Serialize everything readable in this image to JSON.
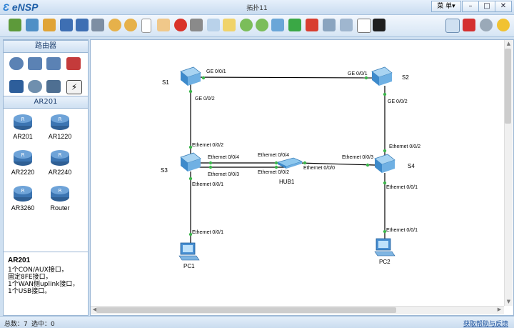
{
  "window": {
    "app_name": "eNSP",
    "title": "拓扑11",
    "menu_label": "菜 单▾",
    "min": "–",
    "restore": "□",
    "close": "✕"
  },
  "toolbar_icons": [
    "new-topology-icon",
    "new-example-icon",
    "open-icon",
    "save-icon",
    "save-as-icon",
    "print-icon",
    "undo-icon",
    "redo-icon",
    "select-icon",
    "hand-icon",
    "delete-icon",
    "delete-all-icon",
    "text-icon",
    "palette-icon",
    "zoom-in-icon",
    "zoom-out-icon",
    "fit-icon",
    "start-icon",
    "stop-icon",
    "capture-icon",
    "topology-icon",
    "fullscreen-icon",
    "terminal-icon",
    "chat-icon",
    "huawei-icon",
    "settings-icon",
    "help-icon"
  ],
  "left_panel": {
    "category_title": "路由器",
    "sub_title": "AR201",
    "devices": [
      "AR201",
      "AR1220",
      "AR2220",
      "AR2240",
      "AR3260",
      "Router"
    ]
  },
  "description": {
    "title": "AR201",
    "lines": [
      "1个CON/AUX接口，",
      "固定8FE接口，",
      "1个WAN侧uplink接口，",
      "1个USB接口。"
    ]
  },
  "topology": {
    "nodes": {
      "s1": "S1",
      "s2": "S2",
      "s3": "S3",
      "s4": "S4",
      "hub": "HUB1",
      "pc1": "PC1",
      "pc2": "PC2"
    },
    "ports": {
      "s1_a": "GE 0/0/1",
      "s2_a": "GE 0/0/1",
      "s1_b": "GE 0/0/2",
      "s2_b": "GE 0/0/2",
      "s3_top": "Ethernet 0/0/2",
      "s4_top": "Ethernet 0/0/2",
      "s3_p4": "Ethernet 0/0/4",
      "s3_p3": "Ethernet 0/0/3",
      "hub_p4": "Ethernet 0/0/4",
      "hub_p2": "Ethernet 0/0/2",
      "hub_p0": "Ethernet 0/0/0",
      "s4_p3": "Ethernet 0/0/3",
      "s3_bottom": "Ethernet 0/0/1",
      "pc1_port": "Ethernet 0/0/1",
      "s4_bottom": "Ethernet 0/0/1",
      "pc2_port": "Ethernet 0/0/1"
    }
  },
  "status": {
    "total": "总数：7",
    "selected": "选中：0",
    "help_link": "获取帮助与反馈"
  },
  "colors": {
    "link": "#000000",
    "port_dot": "#3cb44b",
    "accent": "#1f5fa8"
  }
}
